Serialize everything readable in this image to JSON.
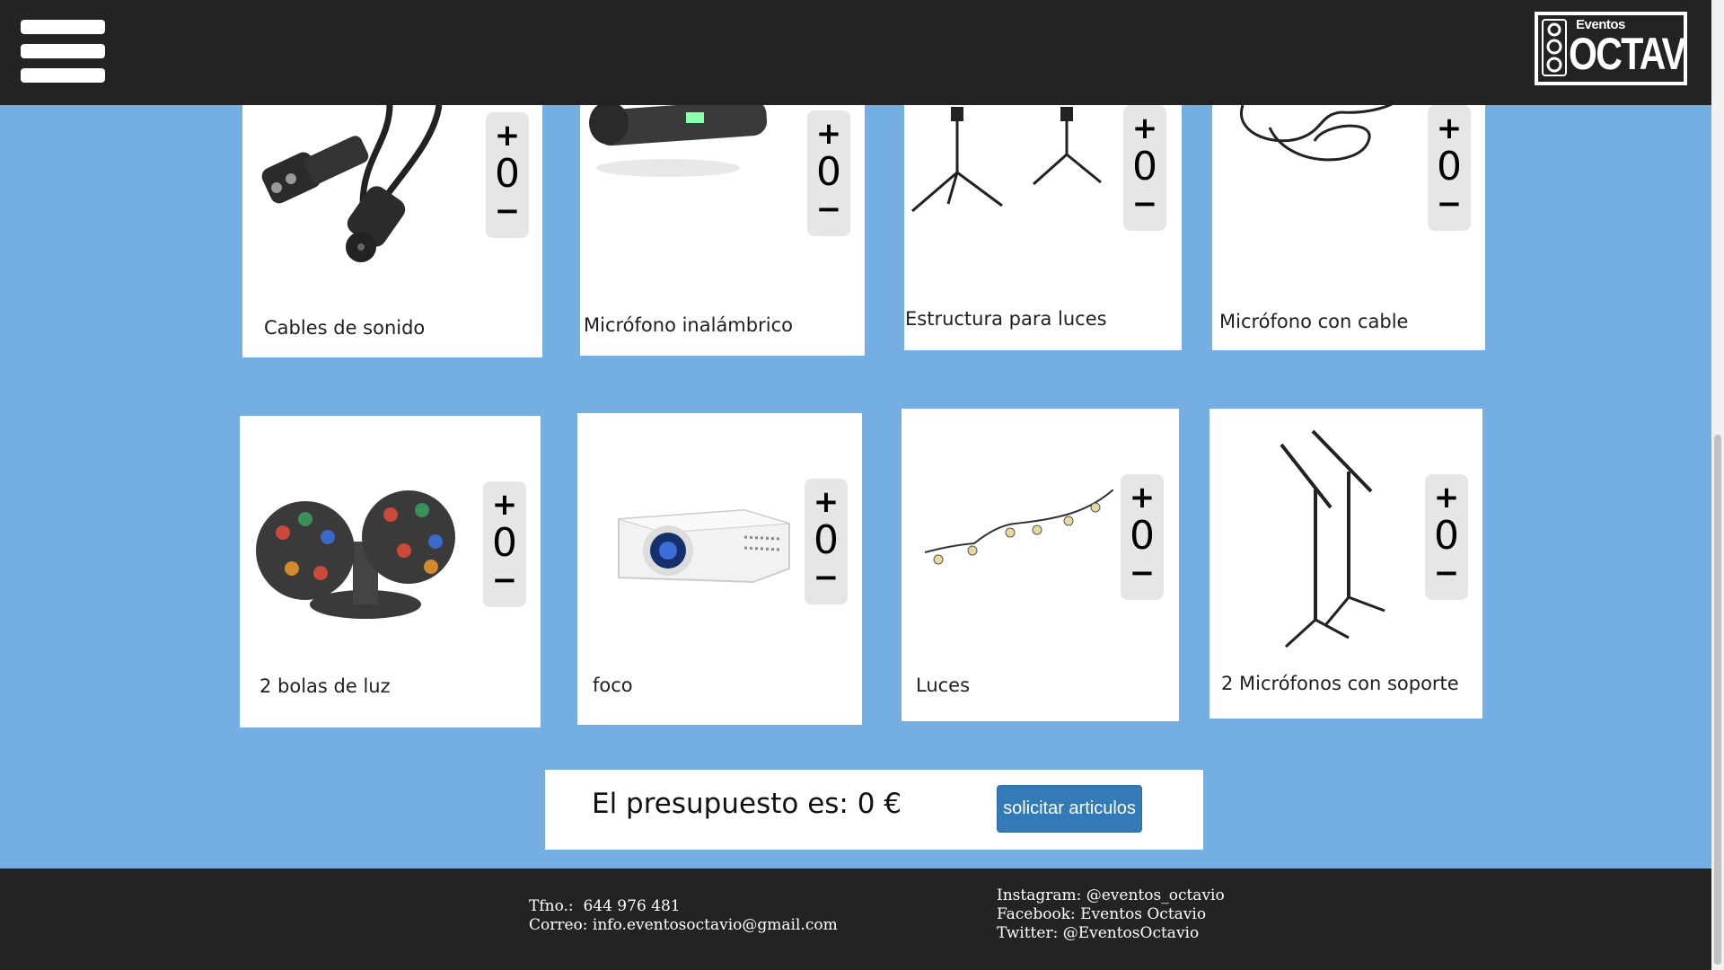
{
  "header": {
    "menu_icon": "hamburger-menu-icon",
    "logo": {
      "small_text": "Eventos",
      "big_text": "OCTAVIO"
    }
  },
  "products": [
    {
      "label": "Cables de sonido",
      "quantity": "0",
      "plus": "+",
      "minus": "−",
      "icon": "xlr-cable-image"
    },
    {
      "label": "Micrófono inalámbrico",
      "quantity": "0",
      "plus": "+",
      "minus": "−",
      "icon": "wireless-microphone-image"
    },
    {
      "label": "Estructura para luces",
      "quantity": "0",
      "plus": "+",
      "minus": "−",
      "icon": "light-stand-image"
    },
    {
      "label": "Micrófono con cable",
      "quantity": "0",
      "plus": "+",
      "minus": "−",
      "icon": "wired-microphone-image"
    },
    {
      "label": "2 bolas de luz",
      "quantity": "0",
      "plus": "+",
      "minus": "−",
      "icon": "disco-balls-image"
    },
    {
      "label": "foco",
      "quantity": "0",
      "plus": "+",
      "minus": "−",
      "icon": "projector-image"
    },
    {
      "label": "Luces",
      "quantity": "0",
      "plus": "+",
      "minus": "−",
      "icon": "string-lights-image"
    },
    {
      "label": "2 Micrófonos con soporte",
      "quantity": "0",
      "plus": "+",
      "minus": "−",
      "icon": "microphone-stands-image"
    }
  ],
  "budget": {
    "text": "El presupuesto es: 0 €",
    "button_label": "solicitar articulos"
  },
  "footer": {
    "phone": "Tfno.:  644 976 481",
    "email": "Correo: info.eventosoctavio@gmail.com",
    "instagram": "Instagram: @eventos_octavio",
    "facebook": "Facebook: Eventos Octavio",
    "twitter": "Twitter: @EventosOctavio"
  },
  "colors": {
    "background": "#75aee3",
    "bars": "#232323",
    "button": "#337ab7"
  }
}
